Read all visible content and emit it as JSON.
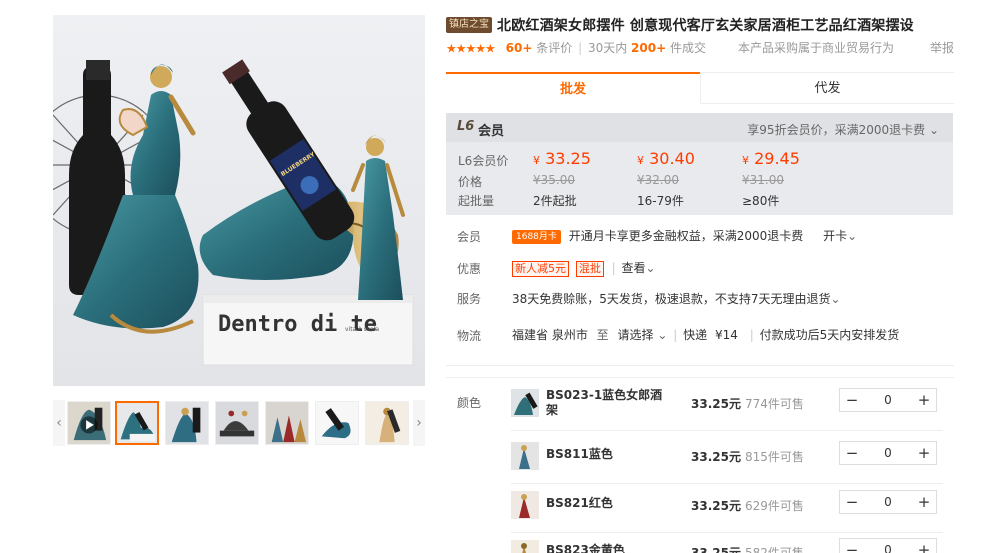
{
  "product": {
    "shop_tag": "镇店之宝",
    "title": "北欧红酒架女郎摆件 创意现代客厅玄关家居酒柜工艺品红酒架摆设"
  },
  "rating": {
    "stars": "★★★★★",
    "count": "60+",
    "count_suffix": "条评价",
    "sep": "|",
    "sales_prefix": "30天内",
    "sales": "200+",
    "sales_suffix": "件成交",
    "trade_note": "本产品采购属于商业贸易行为",
    "report": "举报"
  },
  "tabs": [
    {
      "label": "批发",
      "active": true
    },
    {
      "label": "代发",
      "active": false
    }
  ],
  "member": {
    "level": "L6",
    "title": "会员",
    "promo": "享95折会员价，采满2000退卡费",
    "promo_arrow": "⌄"
  },
  "pricing": {
    "labels": [
      "L6会员价",
      "价格",
      "起批量"
    ],
    "currency": "¥",
    "tiers": [
      {
        "member_price": "33.25",
        "price": "¥35.00",
        "moq": "2件起批"
      },
      {
        "member_price": "30.40",
        "price": "¥32.00",
        "moq": "16-79件"
      },
      {
        "member_price": "29.45",
        "price": "¥31.00",
        "moq": "≥80件"
      }
    ]
  },
  "services": {
    "member": {
      "label": "会员",
      "card_badge": "1688月卡",
      "text": "开通月卡享更多金融权益，采满2000退卡费",
      "action": "开卡",
      "arrow": "⌄"
    },
    "discount": {
      "label": "优惠",
      "coupon": "新人减5元",
      "mix": "混批",
      "view": "查看",
      "arrow": "⌄"
    },
    "service": {
      "label": "服务",
      "text": "38天免费赊账，5天发货，极速退款，不支持7天无理由退货",
      "arrow": "⌄"
    },
    "logistics": {
      "label": "物流",
      "origin": "福建省 泉州市",
      "to": "至",
      "select": "请选择",
      "arrow": "⌄",
      "sep": "|",
      "express": "快递",
      "fee": "¥14",
      "note": "付款成功后5天内安排发货"
    }
  },
  "sku": {
    "label": "颜色",
    "items": [
      {
        "name": "BS023-1蓝色女郎酒架",
        "price": "33.25元",
        "stock": "774件可售",
        "qty": "0",
        "color": "#2f6f7a"
      },
      {
        "name": "BS811蓝色",
        "price": "33.25元",
        "stock": "815件可售",
        "qty": "0",
        "color": "#3b6f8a"
      },
      {
        "name": "BS821红色",
        "price": "33.25元",
        "stock": "629件可售",
        "qty": "0",
        "color": "#9a2a2a"
      },
      {
        "name": "BS823金黄色",
        "price": "33.25元",
        "stock": "582件可售",
        "qty": "0",
        "color": "#b8893b"
      }
    ],
    "minus": "−",
    "plus": "+"
  },
  "colors": {
    "accent": "#ff6a00",
    "price_red": "#ff3c00",
    "teal": "#2e7480"
  },
  "gallery": {
    "book_text": "Dentro di te",
    "book_subtext": "vita è ssola",
    "bottle_label": "BLUEBERRY",
    "prev": "‹",
    "next": "›"
  }
}
